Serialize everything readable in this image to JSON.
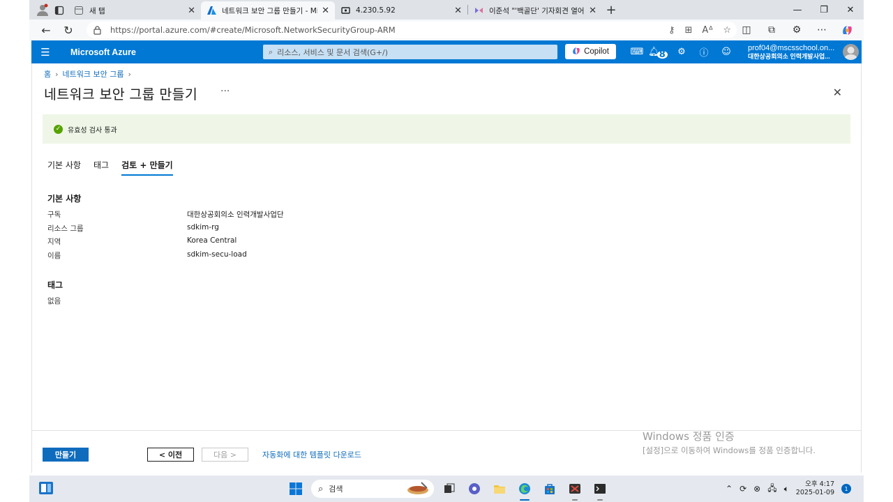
{
  "browser": {
    "tabs": [
      {
        "title": "새 탭",
        "icon": "new-tab-page-icon",
        "active": false
      },
      {
        "title": "네트워크 보안 그룹 만들기 - Micr",
        "icon": "azure-logo-icon",
        "active": true
      },
      {
        "title": "4.230.5.92",
        "icon": "remote-desktop-icon",
        "active": false
      },
      {
        "title": "이준석 \"'백골단' 기자회견 열어준",
        "icon": "news-site-icon",
        "active": false
      }
    ],
    "url": "https://portal.azure.com/#create/Microsoft.NetworkSecurityGroup-ARM"
  },
  "azure_header": {
    "brand": "Microsoft Azure",
    "search_placeholder": "리소스, 서비스 및 문서 검색(G+/)",
    "copilot_label": "Copilot",
    "notification_count": "8",
    "account_email": "prof04@mscsschool.on...",
    "account_org": "대한상공회의소 인력개발사업..."
  },
  "page": {
    "breadcrumb": [
      "홈",
      "네트워크 보안 그룹"
    ],
    "title": "네트워크 보안 그룹 만들기",
    "more": "···",
    "validation_message": "유효성 검사 통과",
    "tabs": [
      "기본 사항",
      "태그",
      "검토 + 만들기"
    ],
    "basics": {
      "heading": "기본 사항",
      "rows": [
        {
          "label": "구독",
          "value": "대한상공회의소 인력개발사업단"
        },
        {
          "label": "리소스 그룹",
          "value": "sdkim-rg"
        },
        {
          "label": "지역",
          "value": "Korea Central"
        },
        {
          "label": "이름",
          "value": "sdkim-secu-load"
        }
      ]
    },
    "tags": {
      "heading": "태그",
      "value": "없음"
    },
    "buttons": {
      "create": "만들기",
      "previous": "< 이전",
      "next": "다음 >",
      "download_template": "자동화에 대한 템플릿 다운로드"
    }
  },
  "watermark": {
    "line1": "Windows 정품 인증",
    "line2": "[설정]으로 이동하여 Windows를 정품 인증합니다."
  },
  "taskbar": {
    "search_label": "검색",
    "time": "오후 4:17",
    "date": "2025-01-09",
    "notification_count": "1"
  },
  "colors": {
    "azure_blue": "#0078d4",
    "link_blue": "#0f6cbd",
    "validation_bg": "#eff6e7",
    "success_green": "#57a300"
  }
}
